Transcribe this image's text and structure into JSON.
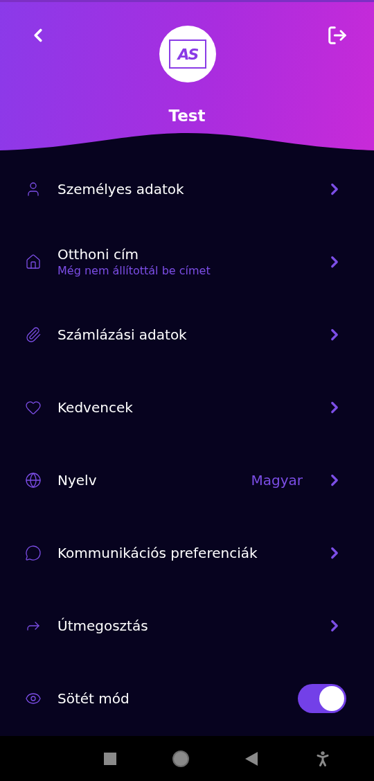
{
  "header": {
    "logo_text": "AS",
    "title": "Test"
  },
  "items": [
    {
      "kind": "link",
      "label": "Személyes adatok"
    },
    {
      "kind": "link",
      "label": "Otthoni cím",
      "subtitle": "Még nem állítottál be címet"
    },
    {
      "kind": "link",
      "label": "Számlázási adatok"
    },
    {
      "kind": "link",
      "label": "Kedvencek"
    },
    {
      "kind": "link",
      "label": "Nyelv",
      "value": "Magyar"
    },
    {
      "kind": "link",
      "label": "Kommunikációs preferenciák"
    },
    {
      "kind": "link",
      "label": "Útmegosztás"
    },
    {
      "kind": "toggle",
      "label": "Sötét mód",
      "on": true
    }
  ]
}
